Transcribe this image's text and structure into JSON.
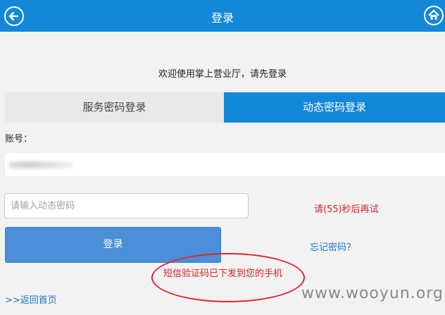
{
  "header": {
    "title": "登录",
    "back_icon": "arrow-left-circle-icon",
    "home_icon": "home-circle-icon"
  },
  "welcome_text": "欢迎使用掌上营业厅，请先登录",
  "tabs": [
    {
      "label": "服务密码登录",
      "active": false
    },
    {
      "label": "动态密码登录",
      "active": true
    }
  ],
  "account": {
    "label": "账号："
  },
  "dynamic_code": {
    "placeholder": "请输入动态密码",
    "value": "",
    "countdown_text": "请(55)秒后再试"
  },
  "actions": {
    "login_label": "登录",
    "forgot_label": "忘记密码？"
  },
  "sms_notice": "短信验证码已下发到您的手机",
  "back_home_link": ">>返回首页",
  "watermark": "www.wooyun.org",
  "colors": {
    "brand_blue": "#1387d8",
    "button_blue": "#4a8fd8",
    "alert_red": "#d3232a",
    "link_blue": "#1a74c5"
  }
}
